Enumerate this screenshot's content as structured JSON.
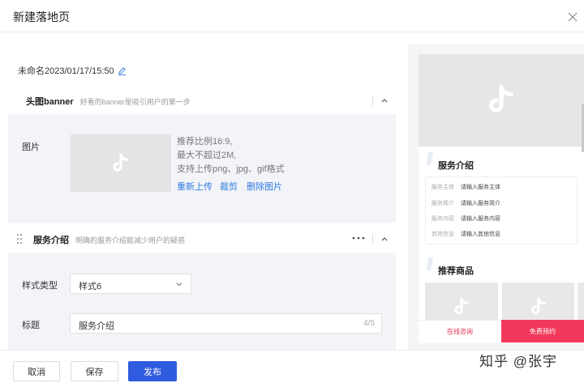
{
  "dialog": {
    "title": "新建落地页"
  },
  "page": {
    "name": "未命名2023/01/17/15:50"
  },
  "banner_section": {
    "title": "头图banner",
    "desc": "好看的banner是吸引用户的第一步",
    "image_label": "图片",
    "tips": [
      "推荐比例16:9,",
      "最大不超过2M,",
      "支持上传png、jpg、gif格式"
    ],
    "actions": {
      "reupload": "重新上传",
      "crop": "裁剪",
      "delete": "删除图片"
    }
  },
  "service_section": {
    "title": "服务介绍",
    "desc": "明确的服务介绍能减少用户的疑惑",
    "style_label": "样式类型",
    "style_value": "样式6",
    "title_label": "标题",
    "title_value": "服务介绍",
    "title_counter": "4/5"
  },
  "footer": {
    "cancel": "取消",
    "save": "保存",
    "publish": "发布"
  },
  "preview": {
    "service_heading": "服务介绍",
    "rows": [
      {
        "key": "服务主体",
        "value": "请输入服务主体"
      },
      {
        "key": "服务简介",
        "value": "请输入服务简介"
      },
      {
        "key": "服务内容",
        "value": "请输入服务内容"
      },
      {
        "key": "其他信息",
        "value": "请输入其他信息"
      }
    ],
    "goods_heading": "推荐商品",
    "consult_button": "在线咨询",
    "reserve_button": "免费预约"
  },
  "watermark": "知乎 @张宇",
  "colors": {
    "primary": "#2f5bdf",
    "link": "#2e7be0",
    "accent": "#f2385a"
  }
}
